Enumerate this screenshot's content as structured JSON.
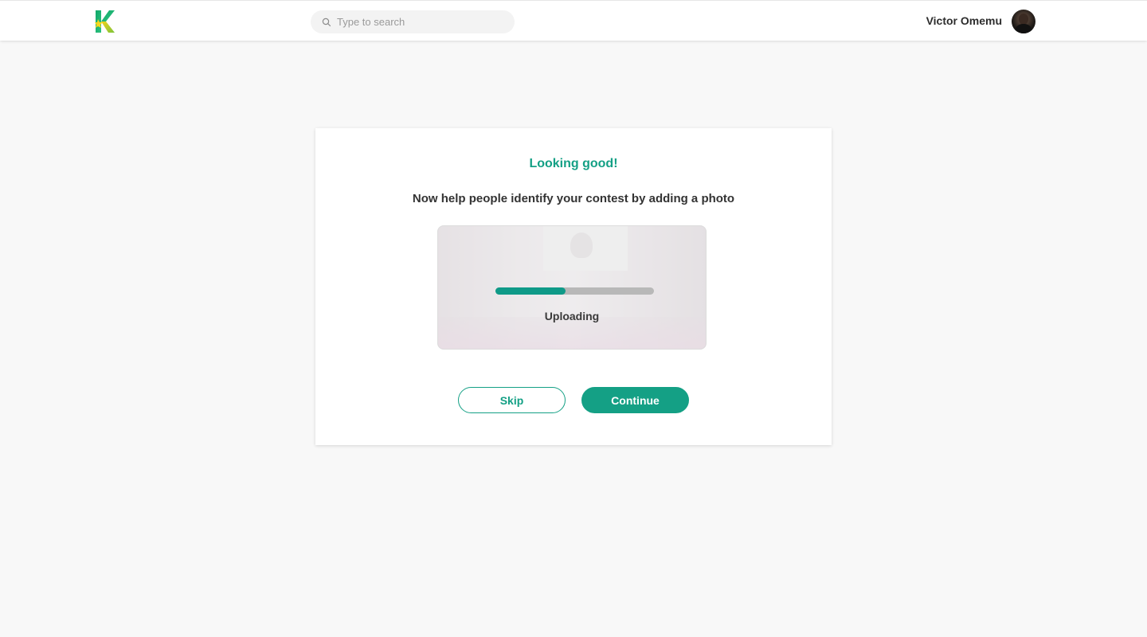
{
  "header": {
    "logo_icon": "kontest-k-logo-icon",
    "search": {
      "placeholder": "Type to search",
      "value": "",
      "icon": "search-icon"
    },
    "user": {
      "name": "Victor Omemu",
      "avatar": "avatar"
    }
  },
  "card": {
    "title": "Looking good!",
    "subtitle": "Now help people identify your contest by adding a photo",
    "upload": {
      "status": "Uploading",
      "progress": 0.44
    },
    "buttons": {
      "skip_label": "Skip",
      "continue_label": "Continue"
    }
  },
  "colors": {
    "accent": "#14a085",
    "progress_fill": "#0f9a88",
    "progress_track": "#b8b8b8",
    "background": "#f8f8f8"
  }
}
